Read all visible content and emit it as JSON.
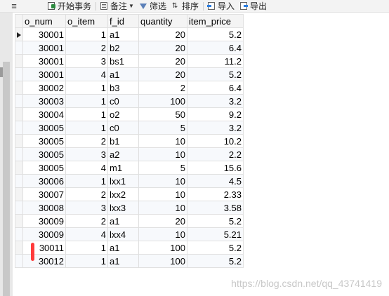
{
  "toolbar": {
    "menu_glyph": "≡",
    "begin_transaction": "开始事务",
    "note": "备注",
    "filter": "筛选",
    "sort": "排序",
    "import": "导入",
    "export": "导出"
  },
  "grid": {
    "columns": [
      "o_num",
      "o_item",
      "f_id",
      "quantity",
      "item_price"
    ],
    "rows": [
      [
        "30001",
        "1",
        "a1",
        "20",
        "5.2"
      ],
      [
        "30001",
        "2",
        "b2",
        "20",
        "6.4"
      ],
      [
        "30001",
        "3",
        "bs1",
        "20",
        "11.2"
      ],
      [
        "30001",
        "4",
        "a1",
        "20",
        "5.2"
      ],
      [
        "30002",
        "1",
        "b3",
        "2",
        "6.4"
      ],
      [
        "30003",
        "1",
        "c0",
        "100",
        "3.2"
      ],
      [
        "30004",
        "1",
        "o2",
        "50",
        "9.2"
      ],
      [
        "30005",
        "1",
        "c0",
        "5",
        "3.2"
      ],
      [
        "30005",
        "2",
        "b1",
        "10",
        "10.2"
      ],
      [
        "30005",
        "3",
        "a2",
        "10",
        "2.2"
      ],
      [
        "30005",
        "4",
        "m1",
        "5",
        "15.6"
      ],
      [
        "30006",
        "1",
        "lxx1",
        "10",
        "4.5"
      ],
      [
        "30007",
        "2",
        "lxx2",
        "10",
        "2.33"
      ],
      [
        "30008",
        "3",
        "lxx3",
        "10",
        "3.58"
      ],
      [
        "30009",
        "2",
        "a1",
        "20",
        "5.2"
      ],
      [
        "30009",
        "4",
        "lxx4",
        "10",
        "5.21"
      ],
      [
        "30011",
        "1",
        "a1",
        "100",
        "5.2"
      ],
      [
        "30012",
        "1",
        "a1",
        "100",
        "5.2"
      ]
    ]
  },
  "watermark": "https://blog.csdn.net/qq_43741419"
}
